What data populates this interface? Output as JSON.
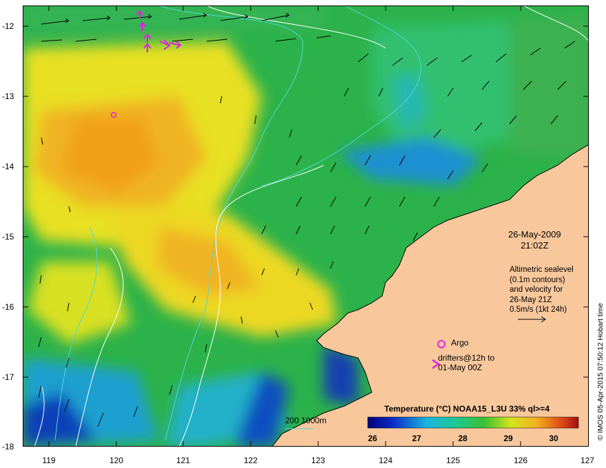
{
  "map": {
    "lat_ticks": [
      "-12",
      "-13",
      "-14",
      "-15",
      "-16",
      "-17",
      "-18"
    ],
    "lon_ticks": [
      "119",
      "120",
      "121",
      "122",
      "123",
      "124",
      "125",
      "126",
      "127"
    ]
  },
  "annotations": {
    "date": "26-May-2009",
    "time": "21:02Z",
    "altimetry_lines": [
      "Altimetric sealevel",
      "(0.1m contours)",
      "and velocity for",
      "26-May 21Z",
      "0.5m/s (1kt 24h)"
    ],
    "argo_label": "Argo",
    "drifter_lines": [
      "drifters@12h to",
      "01-May 00Z"
    ]
  },
  "colorbar": {
    "title": "Temperature (°C) NOAA15_L3U 33% ql>=4",
    "ticks": [
      "26",
      "27",
      "28",
      "29",
      "30"
    ]
  },
  "depth_legend": {
    "label": "200  1000m"
  },
  "credit": "© IMOS 05-Apr-2015 07:50:12 Hobart time",
  "colors": {
    "land": "#f8c89c",
    "ocean_green": "#28b44a",
    "warm_yellow": "#f0e41c",
    "warm_orange": "#f4a820",
    "cool_blue": "#1a6cd8",
    "marker_magenta": "#e020e0",
    "contour_cyan": "#4cd8d8"
  }
}
